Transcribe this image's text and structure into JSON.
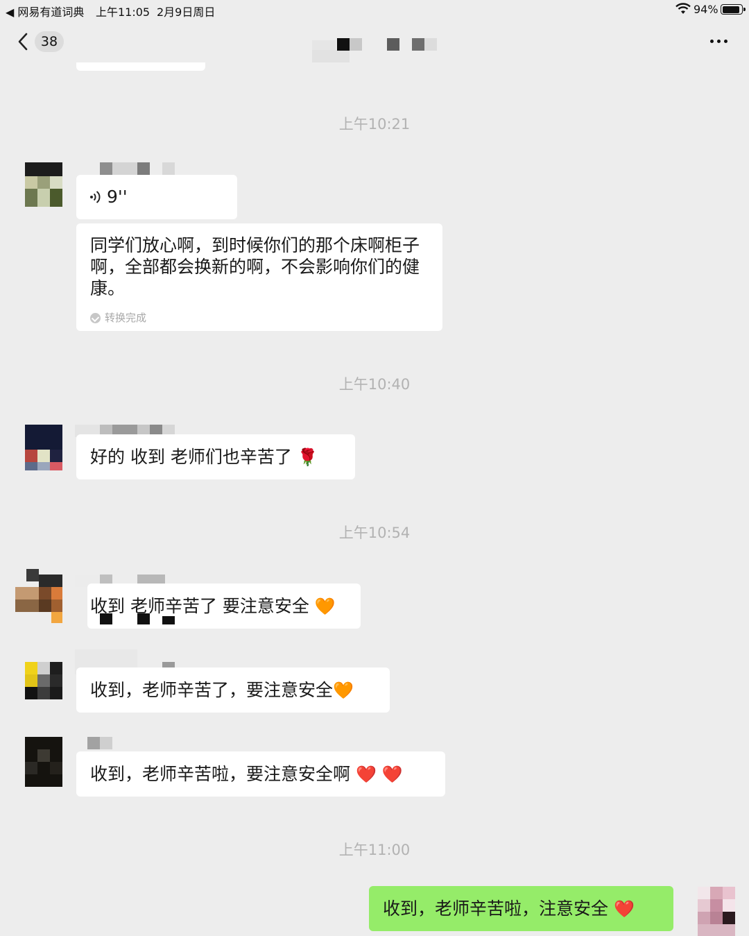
{
  "status_bar": {
    "back_app": "◀ 网易有道词典",
    "time": "上午11:05",
    "date": "2月9日周日",
    "battery_percent": "94%",
    "battery_level": 0.94
  },
  "nav": {
    "unread_count": "38"
  },
  "timestamps": {
    "t1": "上午10:21",
    "t2": "上午10:40",
    "t3": "上午10:54",
    "t4": "上午11:00"
  },
  "messages": {
    "voice": {
      "duration": "9''",
      "transcript": "同学们放心啊，到时候你们的那个床啊柜子啊，全部都会换新的啊，不会影响你们的健康。",
      "status": "转换完成"
    },
    "m2": {
      "text": "好的  收到  老师们也辛苦了",
      "emoji": "🌹"
    },
    "m3": {
      "text": "收到 老师辛苦了 要注意安全",
      "emoji": "🧡"
    },
    "m4": {
      "text": "收到，老师辛苦了，要注意安全",
      "emoji": "🧡"
    },
    "m5": {
      "text": "收到，老师辛苦啦，要注意安全啊",
      "emoji": "❤️ ❤️"
    },
    "m6": {
      "text": "收到，老师辛苦啦，注意安全",
      "emoji": "❤️"
    }
  },
  "colors": {
    "background": "#ededed",
    "bubble_incoming": "#ffffff",
    "bubble_outgoing": "#95ec69",
    "timestamp": "#b2b2b2"
  },
  "icons": [
    "chevron-left-icon",
    "more-dots-icon",
    "wifi-icon",
    "battery-icon",
    "voice-wave-icon",
    "check-circle-icon"
  ]
}
